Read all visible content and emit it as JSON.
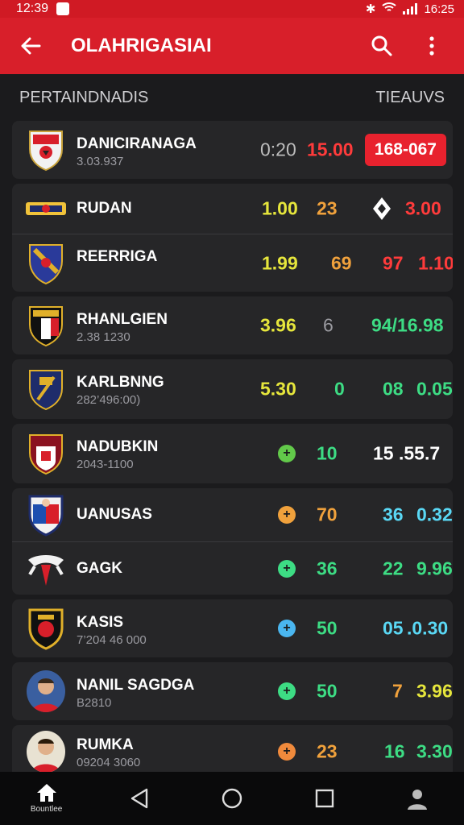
{
  "status": {
    "time_left": "12:39",
    "time_right": "16:25"
  },
  "app": {
    "title": "OLAHRIGASIAI"
  },
  "section": {
    "left": "PERTAINDNADIS",
    "right": "TIEAUVS"
  },
  "colors": {
    "accent": "#d81f2a",
    "yellow": "#e6e63c",
    "orange": "#f0a13c",
    "green": "#3ddc84",
    "red": "#ff3b3b",
    "cyan": "#5ad8f5"
  },
  "rows": [
    {
      "name": "DANICIRANAGA",
      "sub": "3.03.937",
      "v1": "0:20",
      "v2": "15.00",
      "badge": "168-067",
      "crest": "red"
    },
    {
      "name": "RUDAN",
      "v1": "1.00",
      "v2": "23",
      "v3": "3.00",
      "icon": "diamond-icon",
      "crest": "banner"
    },
    {
      "name": "REERRIGA",
      "v1": "1.99",
      "v2": "69",
      "v3": "97",
      "v4": "1.10",
      "crest": "blue"
    },
    {
      "name": "RHANLGIEN",
      "sub": "2.38 1230",
      "v1": "3.96",
      "v2": "6",
      "v3": "94/16.98",
      "crest": "black"
    },
    {
      "name": "KARLBNNG",
      "sub": "282’496:00)",
      "v1": "5.30",
      "v2": "0",
      "v3": "08",
      "v4": "0.05",
      "crest": "navy"
    },
    {
      "name": "NADUBKIN",
      "sub": "2043-1100",
      "dot": "green",
      "v1": "10",
      "v2": "15",
      "v3": ".55.7",
      "crest": "maroon"
    },
    {
      "name": "UANUSAS",
      "dot": "orange",
      "v1": "70",
      "v2": "36",
      "v3": "0.32",
      "crest": "portrait"
    },
    {
      "name": "GAGK",
      "dot": "green",
      "v1": "36",
      "v2": "22",
      "v3": "9.96",
      "crest": "ribbon"
    },
    {
      "name": "KASIS",
      "sub": "7’204 46 000",
      "dot": "cyan",
      "v1": "50",
      "v2": "05",
      "v3": ".0.30",
      "crest": "gold"
    },
    {
      "name": "NANIL SAGDGA",
      "sub": "B2810",
      "dot": "green",
      "v1": "50",
      "v2": "7",
      "v3": "3.96",
      "crest": "player"
    },
    {
      "name": "RUMKA",
      "sub": "09204 3060",
      "dot": "orange",
      "v1": "23",
      "v2": "16",
      "v3": "3.30",
      "crest": "player2"
    }
  ],
  "nav": {
    "home_label": "Bountlee"
  }
}
